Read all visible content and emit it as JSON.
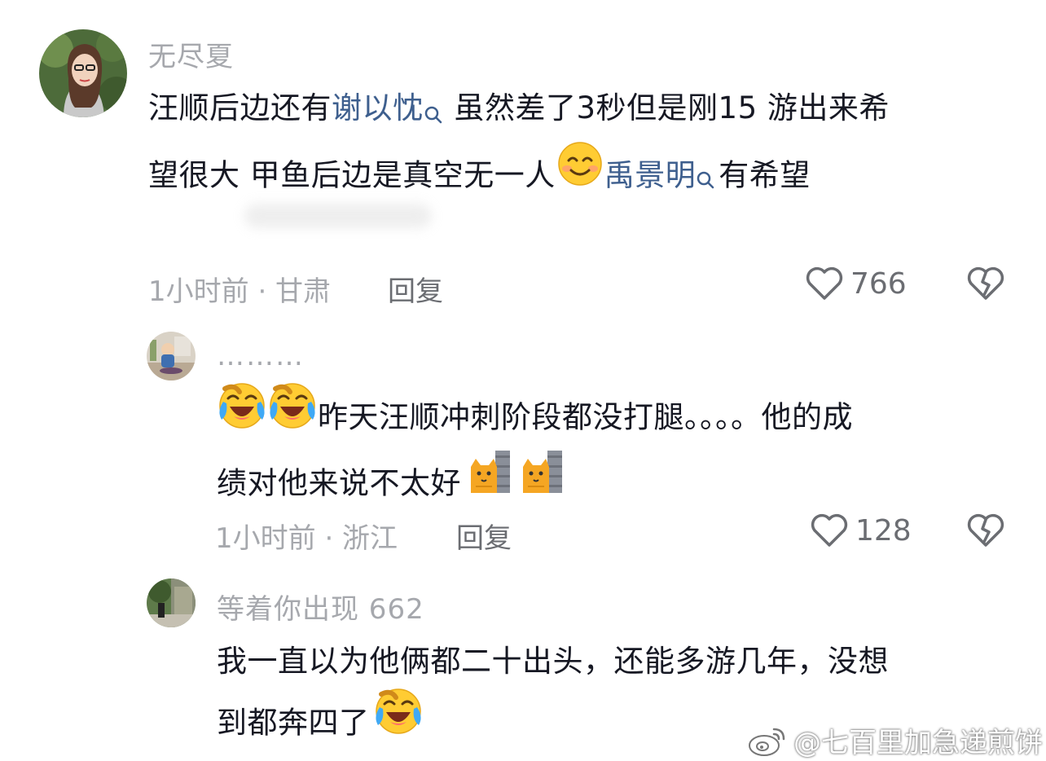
{
  "comments": [
    {
      "username": "无尽夏",
      "body_parts": [
        "汪顺后边还有",
        "谢以忱",
        "虽然差了3秒但是刚15 游出来希",
        "望很大 甲鱼后边是真空无一人",
        "禹景明",
        "有希望"
      ],
      "time_location": "1小时前 · 甘肃",
      "reply_label": "回复",
      "likes": "766"
    },
    {
      "username": "………",
      "body_parts": [
        "昨天汪顺冲刺阶段都没打腿。。。。他的成",
        "绩对他来说不太好"
      ],
      "time_location": "1小时前 · 浙江",
      "reply_label": "回复",
      "likes": "128"
    },
    {
      "username": "等着你出现 662",
      "body_parts": [
        "我一直以为他俩都二十出头，还能多游几年，没想",
        "到都奔四了"
      ]
    }
  ],
  "watermark": "@七百里加急递煎饼",
  "icons": {
    "like": "heart-outline-icon",
    "dislike": "broken-heart-icon",
    "search": "search-icon",
    "emoji_smile": "smiling-face-emoji",
    "emoji_laugh": "laughing-crying-emoji",
    "emoji_cat": "cat-wall-emoji",
    "weibo": "weibo-logo-icon"
  },
  "colors": {
    "text": "#161823",
    "muted": "#a6a8ad",
    "link": "#3e5f8e"
  }
}
